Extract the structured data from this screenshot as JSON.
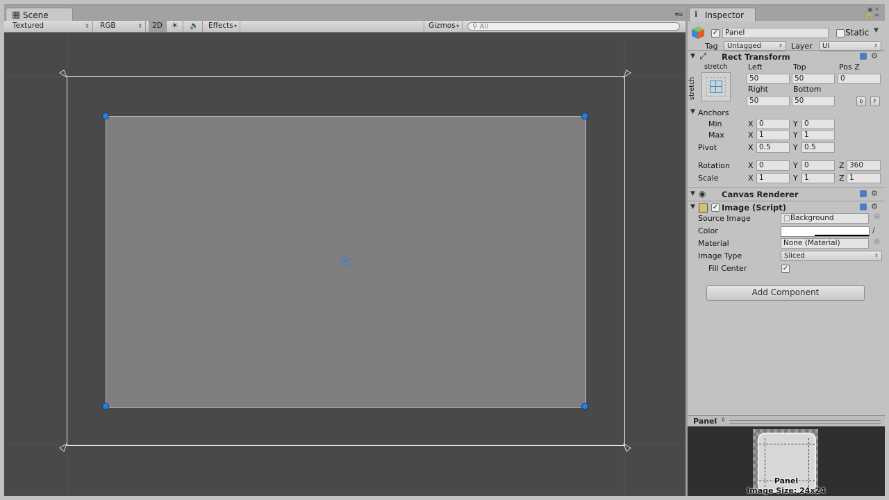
{
  "scene": {
    "tab_label": "Scene",
    "toolbar": {
      "shading": "Textured",
      "render_mode": "RGB",
      "mode_2d": "2D",
      "effects": "Effects",
      "gizmos": "Gizmos",
      "search_placeholder": "All"
    }
  },
  "inspector": {
    "tab_label": "Inspector",
    "object": {
      "active": true,
      "name": "Panel",
      "static_label": "Static",
      "tag_label": "Tag",
      "tag_value": "Untagged",
      "layer_label": "Layer",
      "layer_value": "UI"
    },
    "rect_transform": {
      "title": "Rect Transform",
      "anchor_preset_h": "stretch",
      "anchor_preset_v": "stretch",
      "left_label": "Left",
      "left": "50",
      "top_label": "Top",
      "top": "50",
      "posz_label": "Pos Z",
      "posz": "0",
      "right_label": "Right",
      "right": "50",
      "bottom_label": "Bottom",
      "bottom": "50",
      "blueprint_btn": "b",
      "raw_btn": "F",
      "anchors_label": "Anchors",
      "min_label": "Min",
      "min_x": "0",
      "min_y": "0",
      "max_label": "Max",
      "max_x": "1",
      "max_y": "1",
      "pivot_label": "Pivot",
      "pivot_x": "0.5",
      "pivot_y": "0.5",
      "rotation_label": "Rotation",
      "rot_x": "0",
      "rot_y": "0",
      "rot_z": "360",
      "scale_label": "Scale",
      "scale_x": "1",
      "scale_y": "1",
      "scale_z": "1",
      "x": "X",
      "y": "Y",
      "z": "Z"
    },
    "canvas_renderer": {
      "title": "Canvas Renderer"
    },
    "image": {
      "title": "Image (Script)",
      "enabled": true,
      "source_label": "Source Image",
      "source_value": "Background",
      "color_label": "Color",
      "color_value": "#ffffff",
      "material_label": "Material",
      "material_value": "None (Material)",
      "type_label": "Image Type",
      "type_value": "Sliced",
      "fill_label": "Fill Center",
      "fill_checked": true
    },
    "add_component": "Add Component",
    "preview": {
      "title": "Panel",
      "caption_name": "Panel",
      "caption_size": "Image Size: 24x24"
    }
  }
}
